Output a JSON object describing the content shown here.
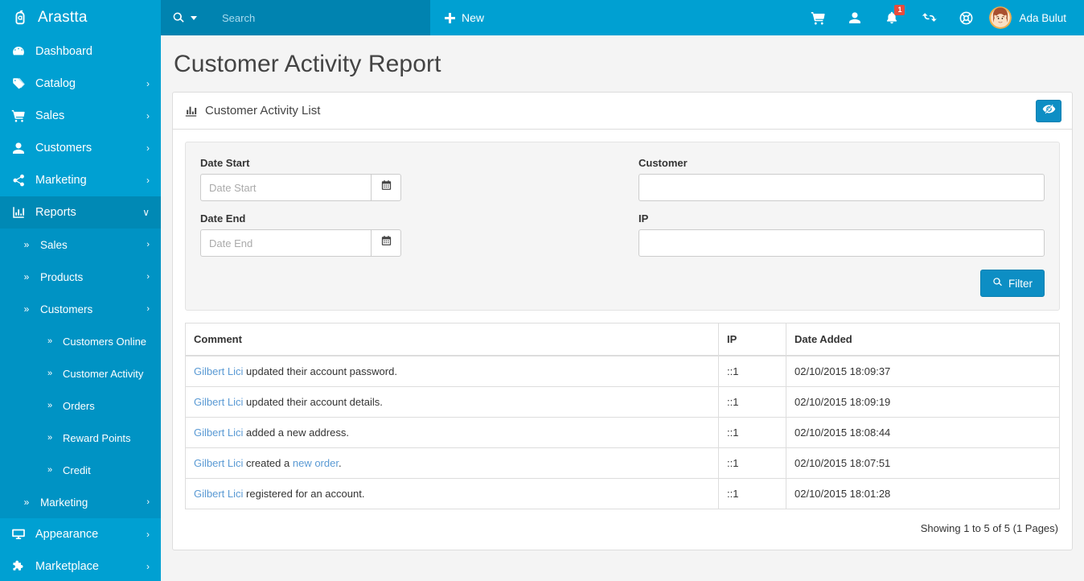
{
  "brand": {
    "name": "Arastta",
    "logo_icon": "shopping-bag-a-logo"
  },
  "sidebar": {
    "items": [
      {
        "label": "Dashboard",
        "icon": "dashboard-gauge-icon",
        "caret": "",
        "active": false
      },
      {
        "label": "Catalog",
        "icon": "tag-icon",
        "caret": "›",
        "active": false
      },
      {
        "label": "Sales",
        "icon": "cart-icon",
        "caret": "›",
        "active": false
      },
      {
        "label": "Customers",
        "icon": "user-icon",
        "caret": "›",
        "active": false
      },
      {
        "label": "Marketing",
        "icon": "share-icon",
        "caret": "›",
        "active": false
      },
      {
        "label": "Reports",
        "icon": "bar-chart-icon",
        "caret": "∨",
        "active": true
      }
    ],
    "reports_submenu": [
      {
        "label": "Sales",
        "chevron": "»",
        "caret": "›"
      },
      {
        "label": "Products",
        "chevron": "»",
        "caret": "›"
      },
      {
        "label": "Customers",
        "chevron": "»",
        "caret": "›"
      }
    ],
    "customers_submenu": [
      {
        "label": "Customers Online",
        "chevron": "»"
      },
      {
        "label": "Customer Activity",
        "chevron": "»"
      },
      {
        "label": "Orders",
        "chevron": "»"
      },
      {
        "label": "Reward Points",
        "chevron": "»"
      },
      {
        "label": "Credit",
        "chevron": "»"
      }
    ],
    "reports_submenu_tail": [
      {
        "label": "Marketing",
        "chevron": "»",
        "caret": "›"
      }
    ],
    "bottom_items": [
      {
        "label": "Appearance",
        "icon": "monitor-icon",
        "caret": "›"
      },
      {
        "label": "Marketplace",
        "icon": "puzzle-piece-icon",
        "caret": "›"
      }
    ]
  },
  "topbar": {
    "search_placeholder": "Search",
    "search_value": "",
    "search_icon": "search-icon",
    "new_label": "New",
    "icons": [
      {
        "name": "cart-icon"
      },
      {
        "name": "user-icon"
      },
      {
        "name": "bell-icon",
        "badge": "1"
      },
      {
        "name": "refresh-icon"
      },
      {
        "name": "lifebuoy-icon"
      }
    ],
    "user_name": "Ada Bulut",
    "avatar_icon": "avatar"
  },
  "page": {
    "title": "Customer Activity Report"
  },
  "panel": {
    "title": "Customer Activity List",
    "title_icon": "bar-chart-icon",
    "toggle_icon": "eye-slash-icon"
  },
  "filter": {
    "date_start": {
      "label": "Date Start",
      "placeholder": "Date Start",
      "value": "",
      "calendar_icon": "calendar-icon"
    },
    "date_end": {
      "label": "Date End",
      "placeholder": "Date End",
      "value": "",
      "calendar_icon": "calendar-icon"
    },
    "customer": {
      "label": "Customer",
      "placeholder": "",
      "value": ""
    },
    "ip": {
      "label": "IP",
      "placeholder": "",
      "value": ""
    },
    "button": {
      "label": "Filter",
      "icon": "search-icon"
    }
  },
  "table": {
    "columns": [
      "Comment",
      "IP",
      "Date Added"
    ],
    "rows": [
      {
        "link": "Gilbert Lici",
        "text": " updated their account password.",
        "link2": "",
        "text2": "",
        "ip": "::1",
        "date": "02/10/2015 18:09:37"
      },
      {
        "link": "Gilbert Lici",
        "text": " updated their account details.",
        "link2": "",
        "text2": "",
        "ip": "::1",
        "date": "02/10/2015 18:09:19"
      },
      {
        "link": "Gilbert Lici",
        "text": " added a new address.",
        "link2": "",
        "text2": "",
        "ip": "::1",
        "date": "02/10/2015 18:08:44"
      },
      {
        "link": "Gilbert Lici",
        "text": " created a ",
        "link2": "new order",
        "text2": ".",
        "ip": "::1",
        "date": "02/10/2015 18:07:51"
      },
      {
        "link": "Gilbert Lici",
        "text": " registered for an account.",
        "link2": "",
        "text2": "",
        "ip": "::1",
        "date": "02/10/2015 18:01:28"
      }
    ],
    "results": "Showing 1 to 5 of 5 (1 Pages)"
  },
  "colors": {
    "sidebar": "#00a0d2",
    "sidebar_active": "#0089b5",
    "submenu": "#0093c4",
    "topbar": "#00a0d2",
    "search_zone": "#0083b0",
    "accent": "#0d8ec4",
    "link": "#5a9ad4",
    "badge": "#e74c3c",
    "page_bg": "#f4f4f4"
  }
}
